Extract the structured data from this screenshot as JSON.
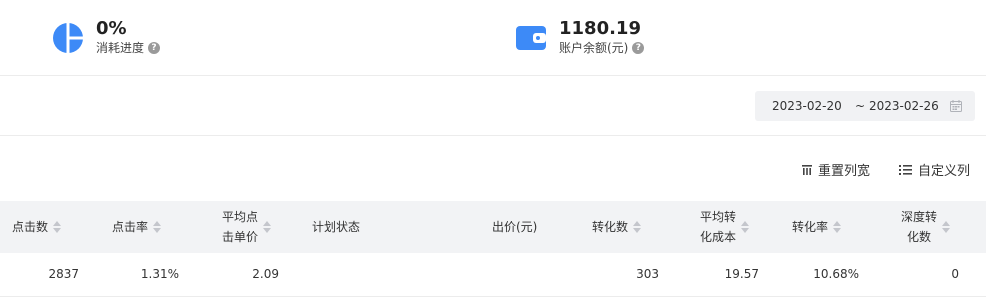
{
  "stats": {
    "progress": {
      "value": "0%",
      "label": "消耗进度",
      "icon": "pie-chart-icon"
    },
    "balance": {
      "value": "1180.19",
      "label": "账户余额(元)",
      "icon": "wallet-icon"
    }
  },
  "date_range": {
    "start": "2023-02-20",
    "separator": "~",
    "end": "2023-02-26"
  },
  "toolbar": {
    "reset_columns": "重置列宽",
    "custom_columns": "自定义列"
  },
  "table": {
    "headers": {
      "clicks": "点击数",
      "ctr": "点击率",
      "avg_cpc_l1": "平均点",
      "avg_cpc_l2": "击单价",
      "plan_status": "计划状态",
      "bid": "出价(元)",
      "conversions": "转化数",
      "avg_cpa_l1": "平均转",
      "avg_cpa_l2": "化成本",
      "cvr": "转化率",
      "deep_conv_l1": "深度转",
      "deep_conv_l2": "化数"
    },
    "rows": [
      {
        "clicks": "2837",
        "ctr": "1.31%",
        "avg_cpc": "2.09",
        "plan_status": "",
        "bid": "",
        "conversions": "303",
        "avg_cpa": "19.57",
        "cvr": "10.68%",
        "deep_conv": "0"
      }
    ]
  },
  "colors": {
    "accent": "#3d8af7",
    "header_bg": "#f2f3f5"
  }
}
